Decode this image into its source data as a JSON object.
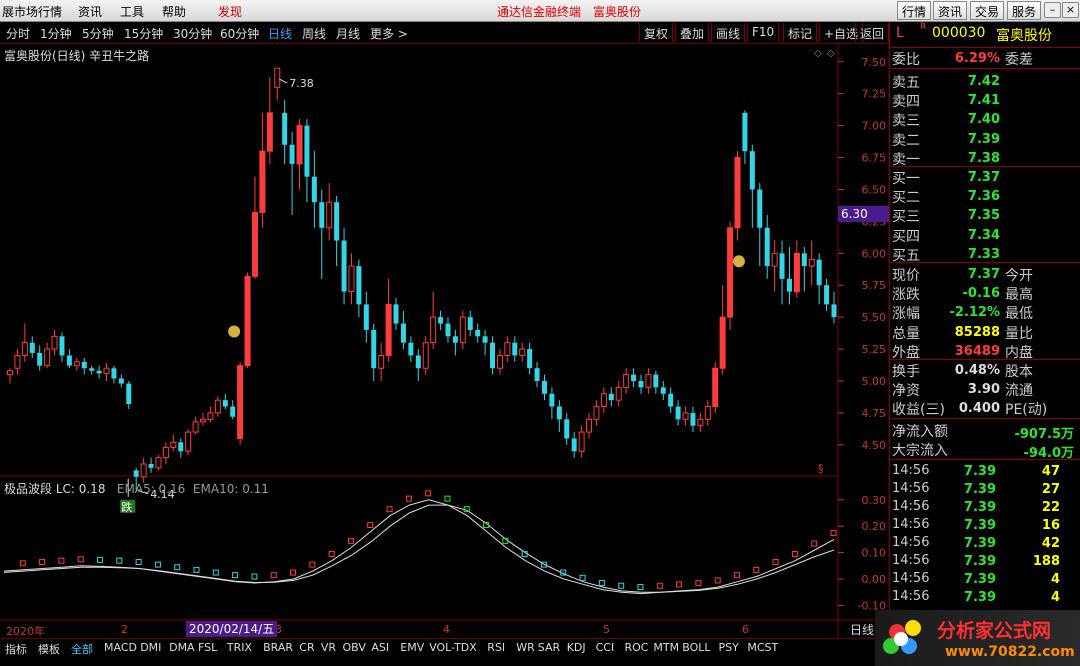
{
  "menu": {
    "left_text": "展市场行情",
    "items": [
      "资讯",
      "工具",
      "帮助",
      "发现"
    ],
    "center_title": "通达信金融终端",
    "stock_title": "富奥股份",
    "right_buttons": [
      "行情",
      "资讯",
      "交易",
      "服务"
    ]
  },
  "periods": [
    "分时",
    "1分钟",
    "5分钟",
    "15分钟",
    "30分钟",
    "60分钟",
    "日线",
    "周线",
    "月线",
    "更多 >"
  ],
  "active_period": "日线",
  "toolbar": [
    "复权",
    "叠加",
    "画线",
    "F10",
    "标记",
    "+自选",
    "返回"
  ],
  "chart": {
    "title": "富奥股份(日线) 辛丑牛之路",
    "sub_title": "极品波段 LC: 0.18",
    "ema5": "EMA5: 0.16",
    "ema10": "EMA10: 0.11",
    "current_price_flag": "6.30",
    "date_flag": "2020/02/14/五",
    "high_label": "7.38",
    "low_label": "4.14",
    "sell_mark": "跌",
    "period_label": "日线"
  },
  "chart_data": [
    {
      "type": "candlestick",
      "title": "富奥股份(日线) 辛丑牛之路",
      "y_ticks": [
        "7.50",
        "7.25",
        "7.00",
        "6.75",
        "6.50",
        "6.25",
        "6.00",
        "5.75",
        "5.50",
        "5.25",
        "5.00",
        "4.75",
        "4.50"
      ],
      "ylim": [
        4.35,
        7.6
      ],
      "x_labels": [
        "2020年",
        "2",
        "3",
        "4",
        "5",
        "6"
      ],
      "candles": [
        [
          5.05,
          5.08,
          4.98,
          5.1
        ],
        [
          5.1,
          5.2,
          5.05,
          5.25
        ],
        [
          5.2,
          5.3,
          5.15,
          5.45
        ],
        [
          5.3,
          5.22,
          5.18,
          5.35
        ],
        [
          5.22,
          5.12,
          5.08,
          5.28
        ],
        [
          5.12,
          5.25,
          5.1,
          5.3
        ],
        [
          5.25,
          5.35,
          5.2,
          5.4
        ],
        [
          5.35,
          5.2,
          5.15,
          5.38
        ],
        [
          5.2,
          5.12,
          5.1,
          5.25
        ],
        [
          5.12,
          5.15,
          5.08,
          5.18
        ],
        [
          5.15,
          5.1,
          5.05,
          5.18
        ],
        [
          5.1,
          5.08,
          5.05,
          5.12
        ],
        [
          5.08,
          5.06,
          5.02,
          5.12
        ],
        [
          5.06,
          5.1,
          5.0,
          5.14
        ],
        [
          5.1,
          5.02,
          4.98,
          5.12
        ],
        [
          5.02,
          4.98,
          4.95,
          5.05
        ],
        [
          4.98,
          4.82,
          4.78,
          5.0
        ],
        [
          4.3,
          4.25,
          4.14,
          4.32
        ],
        [
          4.25,
          4.35,
          4.2,
          4.4
        ],
        [
          4.35,
          4.32,
          4.28,
          4.4
        ],
        [
          4.32,
          4.4,
          4.3,
          4.42
        ],
        [
          4.4,
          4.48,
          4.35,
          4.52
        ],
        [
          4.48,
          4.52,
          4.45,
          4.58
        ],
        [
          4.52,
          4.45,
          4.4,
          4.55
        ],
        [
          4.45,
          4.6,
          4.42,
          4.62
        ],
        [
          4.6,
          4.68,
          4.58,
          4.72
        ],
        [
          4.68,
          4.7,
          4.65,
          4.75
        ],
        [
          4.7,
          4.75,
          4.68,
          4.8
        ],
        [
          4.75,
          4.85,
          4.72,
          4.88
        ],
        [
          4.85,
          4.8,
          4.78,
          4.9
        ],
        [
          4.8,
          4.72,
          4.7,
          4.85
        ],
        [
          4.55,
          5.12,
          4.5,
          5.15
        ],
        [
          5.12,
          5.82,
          5.1,
          5.85
        ],
        [
          5.82,
          6.32,
          5.8,
          6.6
        ],
        [
          6.32,
          6.8,
          6.2,
          7.1
        ],
        [
          6.8,
          7.1,
          6.7,
          7.38
        ],
        [
          7.3,
          7.45,
          7.2,
          7.38
        ],
        [
          7.1,
          6.85,
          6.7,
          7.2
        ],
        [
          6.85,
          6.7,
          6.3,
          6.95
        ],
        [
          6.7,
          7.0,
          6.5,
          7.05
        ],
        [
          7.0,
          6.6,
          6.4,
          7.05
        ],
        [
          6.6,
          6.4,
          6.2,
          6.8
        ],
        [
          6.4,
          6.2,
          5.8,
          6.5
        ],
        [
          6.2,
          6.4,
          6.1,
          6.55
        ],
        [
          6.4,
          6.1,
          5.9,
          6.45
        ],
        [
          6.1,
          5.7,
          5.6,
          6.2
        ],
        [
          5.7,
          5.9,
          5.6,
          6.0
        ],
        [
          5.9,
          5.6,
          5.5,
          5.95
        ],
        [
          5.6,
          5.4,
          5.3,
          5.7
        ],
        [
          5.4,
          5.1,
          5.0,
          5.45
        ],
        [
          5.1,
          5.2,
          5.0,
          5.3
        ],
        [
          5.2,
          5.6,
          5.15,
          5.8
        ],
        [
          5.6,
          5.45,
          5.4,
          5.65
        ],
        [
          5.45,
          5.3,
          5.25,
          5.55
        ],
        [
          5.3,
          5.2,
          5.15,
          5.35
        ],
        [
          5.2,
          5.1,
          5.0,
          5.25
        ],
        [
          5.1,
          5.3,
          5.05,
          5.35
        ],
        [
          5.3,
          5.5,
          5.25,
          5.7
        ],
        [
          5.5,
          5.45,
          5.4,
          5.55
        ],
        [
          5.45,
          5.35,
          5.3,
          5.5
        ],
        [
          5.35,
          5.3,
          5.2,
          5.4
        ],
        [
          5.3,
          5.5,
          5.25,
          5.55
        ],
        [
          5.5,
          5.4,
          5.35,
          5.55
        ],
        [
          5.4,
          5.35,
          5.3,
          5.45
        ],
        [
          5.35,
          5.3,
          5.2,
          5.4
        ],
        [
          5.3,
          5.1,
          5.05,
          5.35
        ],
        [
          5.1,
          5.2,
          5.05,
          5.25
        ],
        [
          5.2,
          5.3,
          5.15,
          5.35
        ],
        [
          5.3,
          5.2,
          5.15,
          5.35
        ],
        [
          5.2,
          5.25,
          5.15,
          5.3
        ],
        [
          5.25,
          5.1,
          5.05,
          5.3
        ],
        [
          5.1,
          5.0,
          4.95,
          5.15
        ],
        [
          5.0,
          4.9,
          4.85,
          5.05
        ],
        [
          4.9,
          4.8,
          4.7,
          4.95
        ],
        [
          4.8,
          4.7,
          4.6,
          4.85
        ],
        [
          4.7,
          4.55,
          4.5,
          4.75
        ],
        [
          4.55,
          4.45,
          4.4,
          4.6
        ],
        [
          4.45,
          4.6,
          4.4,
          4.65
        ],
        [
          4.6,
          4.7,
          4.55,
          4.75
        ],
        [
          4.7,
          4.8,
          4.65,
          4.85
        ],
        [
          4.8,
          4.9,
          4.75,
          4.95
        ],
        [
          4.9,
          4.85,
          4.8,
          4.95
        ],
        [
          4.85,
          4.95,
          4.8,
          5.0
        ],
        [
          4.95,
          5.05,
          4.9,
          5.1
        ],
        [
          5.05,
          5.0,
          4.95,
          5.1
        ],
        [
          5.0,
          4.95,
          4.9,
          5.05
        ],
        [
          4.95,
          5.05,
          4.9,
          5.1
        ],
        [
          5.05,
          4.95,
          4.9,
          5.08
        ],
        [
          4.95,
          4.9,
          4.85,
          5.0
        ],
        [
          4.9,
          4.8,
          4.75,
          4.95
        ],
        [
          4.8,
          4.7,
          4.65,
          4.85
        ],
        [
          4.7,
          4.75,
          4.65,
          4.8
        ],
        [
          4.75,
          4.65,
          4.6,
          4.8
        ],
        [
          4.65,
          4.7,
          4.6,
          4.75
        ],
        [
          4.7,
          4.8,
          4.65,
          4.85
        ],
        [
          4.8,
          5.1,
          4.75,
          5.15
        ],
        [
          5.1,
          5.5,
          5.05,
          5.75
        ],
        [
          5.5,
          6.2,
          5.4,
          6.25
        ],
        [
          6.2,
          6.75,
          6.1,
          6.8
        ],
        [
          7.1,
          6.8,
          6.7,
          7.12
        ],
        [
          6.8,
          6.5,
          6.2,
          6.85
        ],
        [
          6.5,
          6.2,
          5.9,
          6.55
        ],
        [
          6.2,
          5.9,
          5.8,
          6.3
        ],
        [
          5.9,
          6.0,
          5.7,
          6.1
        ],
        [
          6.0,
          5.8,
          5.6,
          6.1
        ],
        [
          5.8,
          5.7,
          5.6,
          6.05
        ],
        [
          5.7,
          6.0,
          5.65,
          6.1
        ],
        [
          6.0,
          5.9,
          5.7,
          6.05
        ],
        [
          5.9,
          5.95,
          5.75,
          6.1
        ],
        [
          5.95,
          5.75,
          5.6,
          6.0
        ],
        [
          5.75,
          5.6,
          5.55,
          5.8
        ],
        [
          5.6,
          5.5,
          5.45,
          5.7
        ]
      ]
    },
    {
      "type": "line",
      "title": "极品波段",
      "series": [
        {
          "name": "EMA5",
          "values": [
            0.03,
            0.035,
            0.04,
            0.045,
            0.05,
            0.048,
            0.045,
            0.04,
            0.03,
            0.02,
            0.01,
            0.0,
            -0.01,
            -0.015,
            -0.01,
            0.0,
            0.03,
            0.07,
            0.12,
            0.18,
            0.24,
            0.28,
            0.3,
            0.28,
            0.24,
            0.18,
            0.12,
            0.07,
            0.03,
            0.0,
            -0.02,
            -0.04,
            -0.05,
            -0.055,
            -0.05,
            -0.045,
            -0.04,
            -0.03,
            -0.01,
            0.01,
            0.04,
            0.07,
            0.11,
            0.15
          ]
        },
        {
          "name": "EMA10",
          "values": [
            0.025,
            0.03,
            0.035,
            0.04,
            0.045,
            0.045,
            0.043,
            0.04,
            0.032,
            0.022,
            0.012,
            0.002,
            -0.008,
            -0.013,
            -0.012,
            -0.005,
            0.015,
            0.05,
            0.09,
            0.14,
            0.2,
            0.25,
            0.28,
            0.28,
            0.26,
            0.21,
            0.15,
            0.1,
            0.055,
            0.02,
            -0.01,
            -0.03,
            -0.045,
            -0.05,
            -0.05,
            -0.047,
            -0.043,
            -0.035,
            -0.02,
            0.0,
            0.025,
            0.055,
            0.085,
            0.11
          ]
        }
      ],
      "y_ticks": [
        "0.30",
        "0.20",
        "0.10",
        "0.00",
        "-0.10"
      ],
      "ylim": [
        -0.14,
        0.36
      ]
    }
  ],
  "quote": {
    "flag": "L",
    "flag2": "R",
    "code": "000030",
    "name": "富奥股份",
    "weibi": {
      "label": "委比",
      "value": "6.29%",
      "label2": "委差"
    },
    "sells": [
      {
        "label": "卖五",
        "price": "7.42"
      },
      {
        "label": "卖四",
        "price": "7.41"
      },
      {
        "label": "卖三",
        "price": "7.40"
      },
      {
        "label": "卖二",
        "price": "7.39"
      },
      {
        "label": "卖一",
        "price": "7.38"
      }
    ],
    "buys": [
      {
        "label": "买一",
        "price": "7.37"
      },
      {
        "label": "买二",
        "price": "7.36"
      },
      {
        "label": "买三",
        "price": "7.35"
      },
      {
        "label": "买四",
        "price": "7.34"
      },
      {
        "label": "买五",
        "price": "7.33"
      }
    ],
    "stats": [
      {
        "label": "现价",
        "value": "7.37",
        "label2": "今开",
        "color": "green"
      },
      {
        "label": "涨跌",
        "value": "-0.16",
        "label2": "最高",
        "color": "green"
      },
      {
        "label": "涨幅",
        "value": "-2.12%",
        "label2": "最低",
        "color": "green"
      },
      {
        "label": "总量",
        "value": "85288",
        "label2": "量比",
        "color": "yellow"
      },
      {
        "label": "外盘",
        "value": "36489",
        "label2": "内盘",
        "color": "red"
      }
    ],
    "fund": [
      {
        "label": "换手",
        "value": "0.48%",
        "label2": "股本"
      },
      {
        "label": "净资",
        "value": "3.90",
        "label2": "流通"
      },
      {
        "label": "收益(三)",
        "value": "0.400",
        "label2": "PE(动)"
      }
    ],
    "flows": [
      {
        "label": "净流入额",
        "value": "-907.5万"
      },
      {
        "label": "大宗流入",
        "value": "-94.0万"
      }
    ],
    "ticks": [
      {
        "time": "14:56",
        "price": "7.39",
        "vol": "47"
      },
      {
        "time": "14:56",
        "price": "7.39",
        "vol": "27"
      },
      {
        "time": "14:56",
        "price": "7.39",
        "vol": "22"
      },
      {
        "time": "14:56",
        "price": "7.39",
        "vol": "16"
      },
      {
        "time": "14:56",
        "price": "7.39",
        "vol": "42"
      },
      {
        "time": "14:56",
        "price": "7.39",
        "vol": "188"
      },
      {
        "time": "14:56",
        "price": "7.39",
        "vol": "4"
      },
      {
        "time": "14:56",
        "price": "7.39",
        "vol": "4"
      }
    ]
  },
  "bottom_tabs": [
    "指标",
    "模板",
    "全部",
    "MACD",
    "DMI",
    "DMA",
    "FSL",
    "TRIX",
    "BRAR",
    "CR",
    "VR",
    "OBV",
    "ASI",
    "EMV",
    "VOL-TDX",
    "RSI",
    "WR",
    "SAR",
    "KDJ",
    "CCI",
    "ROC",
    "MTM",
    "BOLL",
    "PSY",
    "MCST"
  ],
  "active_tab": "全部",
  "watermark": {
    "text": "分析家公式网",
    "url": "www.70822.com"
  },
  "colors": {
    "up": "#ff3c3c",
    "down": "#33d6e6",
    "green": "#2ee62e",
    "yellow": "#ffff00",
    "accent": "#3c9cff",
    "flag": "#4b1a8c"
  }
}
